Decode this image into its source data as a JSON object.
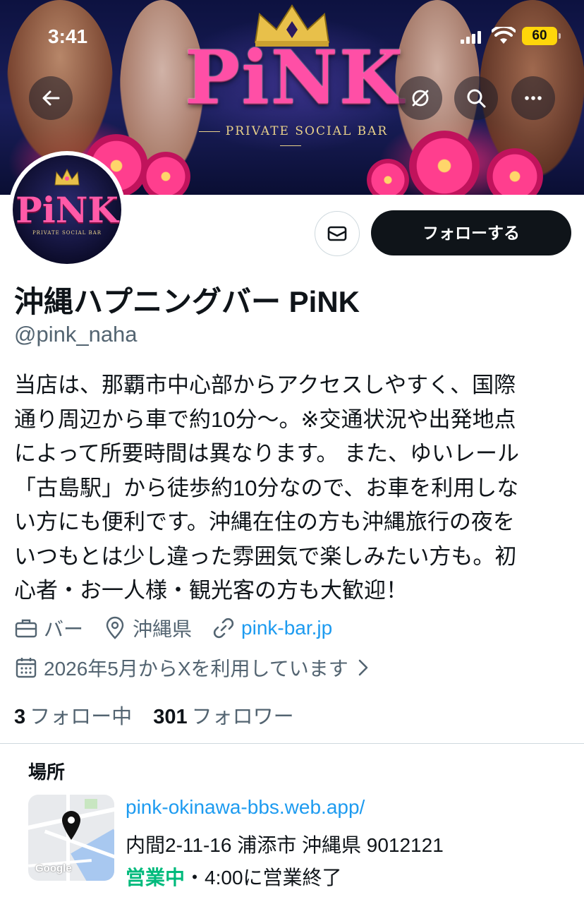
{
  "status_bar": {
    "time": "3:41",
    "battery": "60"
  },
  "banner": {
    "logo_text": "PiNK",
    "logo_subtitle": "PRIVATE SOCIAL BAR"
  },
  "avatar": {
    "logo_text": "PiNK",
    "logo_subtitle": "PRIVATE SOCIAL BAR"
  },
  "profile": {
    "name": "沖縄ハプニングバー PiNK",
    "handle": "@pink_naha",
    "bio_lines": [
      "当店は、那覇市中心部からアクセスしやすく、国際",
      "通り周辺から車で約10分〜。※交通状況や出発地点",
      "によって所要時間は異なります。 また、ゆいレール",
      "「古島駅」から徒歩約10分なので、お車を利用しな",
      "い方にも便利です。沖縄在住の方も沖縄旅行の夜を",
      "いつもとは少し違った雰囲気で楽しみたい方も。初",
      "心者・お一人様・観光客の方も大歓迎！"
    ],
    "category": "バー",
    "location": "沖縄県",
    "website": "pink-bar.jp",
    "joined": "2026年5月からXを利用しています",
    "following_count": "3",
    "following_label": "フォロー中",
    "followers_count": "301",
    "followers_label": "フォロワー"
  },
  "actions": {
    "follow_label": "フォローする"
  },
  "location_card": {
    "title": "場所",
    "url": "pink-okinawa-bbs.web.app/",
    "address": "内間2-11-16 浦添市 沖縄県 9012121",
    "status": "営業中",
    "hours": "・4:00に営業終了",
    "map_label": "Google"
  },
  "colors": {
    "accent_link": "#1d9bf0",
    "open_green": "#00ba7c",
    "follow_button": "#0f1419"
  }
}
